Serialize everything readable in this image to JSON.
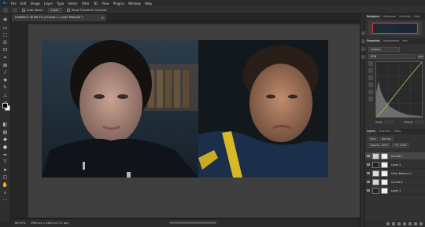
{
  "app": {
    "logo": "Ps"
  },
  "menu": [
    "File",
    "Edit",
    "Image",
    "Layer",
    "Type",
    "Select",
    "Filter",
    "3D",
    "View",
    "Plugins",
    "Window",
    "Help"
  ],
  "options": {
    "auto_select": "Auto-Select",
    "layer_dropdown": "Layer",
    "show_transform": "Show Transform Controls"
  },
  "document": {
    "tab_title": "Untitled-1 @ 66.7% (Curves 1, Layer Mask/8) *",
    "close": "×"
  },
  "status": {
    "zoom": "66.67%",
    "doc_info": "2560 px x 1440 px (72 ppi)"
  },
  "tools": [
    {
      "icon": "move-tool-icon",
      "glyph": "✥"
    },
    {
      "icon": "artboard-tool-icon",
      "glyph": "▭"
    },
    {
      "icon": "marquee-tool-icon",
      "glyph": "⬚"
    },
    {
      "icon": "lasso-tool-icon",
      "glyph": "ʘ"
    },
    {
      "icon": "object-select-tool-icon",
      "glyph": "⊡"
    },
    {
      "icon": "crop-tool-icon",
      "glyph": "⌗"
    },
    {
      "icon": "frame-tool-icon",
      "glyph": "⊠"
    },
    {
      "icon": "eyedropper-tool-icon",
      "glyph": "⁄"
    },
    {
      "icon": "healing-brush-tool-icon",
      "glyph": "✚"
    },
    {
      "icon": "brush-tool-icon",
      "glyph": "✎"
    },
    {
      "icon": "clone-stamp-tool-icon",
      "glyph": "⊥"
    },
    {
      "icon": "history-brush-tool-icon",
      "glyph": "↺"
    },
    {
      "icon": "eraser-tool-icon",
      "glyph": "◧"
    },
    {
      "icon": "gradient-tool-icon",
      "glyph": "▤"
    },
    {
      "icon": "blur-tool-icon",
      "glyph": "◆"
    },
    {
      "icon": "dodge-tool-icon",
      "glyph": "●"
    },
    {
      "icon": "pen-tool-icon",
      "glyph": "✒"
    },
    {
      "icon": "type-tool-icon",
      "glyph": "T"
    },
    {
      "icon": "path-select-tool-icon",
      "glyph": "➤"
    },
    {
      "icon": "shape-tool-icon",
      "glyph": "▢"
    },
    {
      "icon": "hand-tool-icon",
      "glyph": "✋"
    },
    {
      "icon": "zoom-tool-icon",
      "glyph": "⌕"
    },
    {
      "icon": "more-tools-icon",
      "glyph": "⋯"
    }
  ],
  "panels": {
    "nav_tabs": [
      "Navigator",
      "Histogram",
      "Libraries",
      "Color"
    ],
    "props_tabs": [
      "Properties",
      "Adjustments",
      "Info"
    ],
    "curves": {
      "preset": "Custom",
      "channel": "RGB",
      "auto": "Auto",
      "input_label": "Input:",
      "output_label": "Output:"
    },
    "layers_tabs": [
      "Layers",
      "Channels",
      "Paths"
    ],
    "layer_options": {
      "kind": "Kind",
      "blend": "Normal",
      "opacity": "Opacity: 100%",
      "fill": "Fill: 100%"
    },
    "layers": [
      {
        "name": "Curves 1",
        "thumb": "#cfcfcf"
      },
      {
        "name": "Layer 2",
        "thumb": "#1a2530"
      },
      {
        "name": "Color Balance 1",
        "thumb": "#dcdcdc"
      },
      {
        "name": "Curves 2",
        "thumb": "#d5d5d5"
      },
      {
        "name": "Layer 1",
        "thumb": "#1f2a38"
      }
    ]
  },
  "colors": {
    "foreground": "#000000",
    "background": "#ffffff",
    "accent": "#31a8ff",
    "curve_line": "#7ccf5a"
  }
}
